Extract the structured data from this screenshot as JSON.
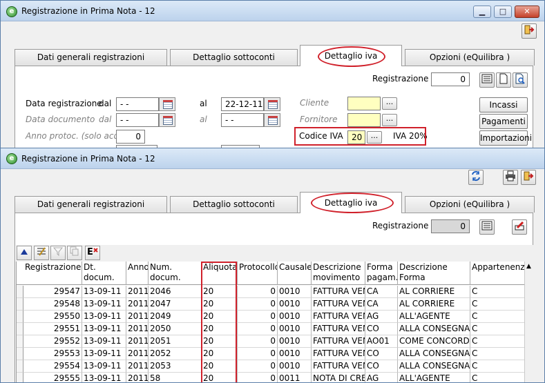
{
  "window1": {
    "title": "Registrazione in Prima Nota - 12",
    "tabs": [
      "Dati generali registrazioni",
      "Dettaglio sottoconti",
      "Dettaglio iva",
      "Opzioni (eQuilibra )"
    ],
    "registrazione_label": "Registrazione",
    "registrazione_value": "0",
    "data_registrazione_label": "Data registrazione",
    "dal_label": "dal",
    "al_label": "al",
    "data_reg_dal": "- -",
    "data_reg_al": "22-12-11",
    "data_documento_label": "Data documento",
    "data_doc_dal": "- -",
    "data_doc_al": "- -",
    "anno_protoc_label": "Anno protoc. (solo acq.)",
    "anno_protoc_value": "0",
    "cliente_label": "Cliente",
    "fornitore_label": "Fornitore",
    "codice_iva_label": "Codice IVA",
    "codice_iva_value": "20",
    "iva_desc": "IVA 20%",
    "dots": "...",
    "side_buttons": [
      "Incassi",
      "Pagamenti",
      "Importazioni"
    ]
  },
  "window2": {
    "title": "Registrazione in Prima Nota - 12",
    "tabs": [
      "Dati generali registrazioni",
      "Dettaglio sottoconti",
      "Dettaglio iva",
      "Opzioni (eQuilibra )"
    ],
    "registrazione_label": "Registrazione",
    "registrazione_value": "0",
    "columns": [
      "Registrazione",
      "Dt. docum.",
      "Anno",
      "Num. docum.",
      "Aliquota",
      "Protocollo",
      "Causale",
      "Descrizione\nmovimento",
      "Forma\npagam.",
      "Descrizione Forma\npagam.",
      "Appartenenza"
    ],
    "rows": [
      [
        "29547",
        "13-09-11",
        "2011",
        "2046",
        "20",
        "0",
        "0010",
        "FATTURA VENDITA",
        "CA",
        "AL CORRIERE",
        "C"
      ],
      [
        "29548",
        "13-09-11",
        "2011",
        "2047",
        "20",
        "0",
        "0010",
        "FATTURA VENDITA",
        "CA",
        "AL CORRIERE",
        "C"
      ],
      [
        "29550",
        "13-09-11",
        "2011",
        "2049",
        "20",
        "0",
        "0010",
        "FATTURA VENDITA",
        "AG",
        "ALL'AGENTE",
        "C"
      ],
      [
        "29551",
        "13-09-11",
        "2011",
        "2050",
        "20",
        "0",
        "0010",
        "FATTURA VENDITA",
        "CO",
        "ALLA CONSEGNA",
        "C"
      ],
      [
        "29552",
        "13-09-11",
        "2011",
        "2051",
        "20",
        "0",
        "0010",
        "FATTURA VENDITA",
        "AO01",
        "COME CONCORDATO",
        "C"
      ],
      [
        "29553",
        "13-09-11",
        "2011",
        "2052",
        "20",
        "0",
        "0010",
        "FATTURA VENDITA",
        "CO",
        "ALLA CONSEGNA",
        "C"
      ],
      [
        "29554",
        "13-09-11",
        "2011",
        "2053",
        "20",
        "0",
        "0010",
        "FATTURA VENDITA",
        "CO",
        "ALLA CONSEGNA",
        "C"
      ],
      [
        "29555",
        "13-09-11",
        "2011",
        "58",
        "20",
        "0",
        "0011",
        "NOTA DI CREDITO",
        "AG",
        "ALL'AGENTE",
        "C"
      ]
    ]
  }
}
